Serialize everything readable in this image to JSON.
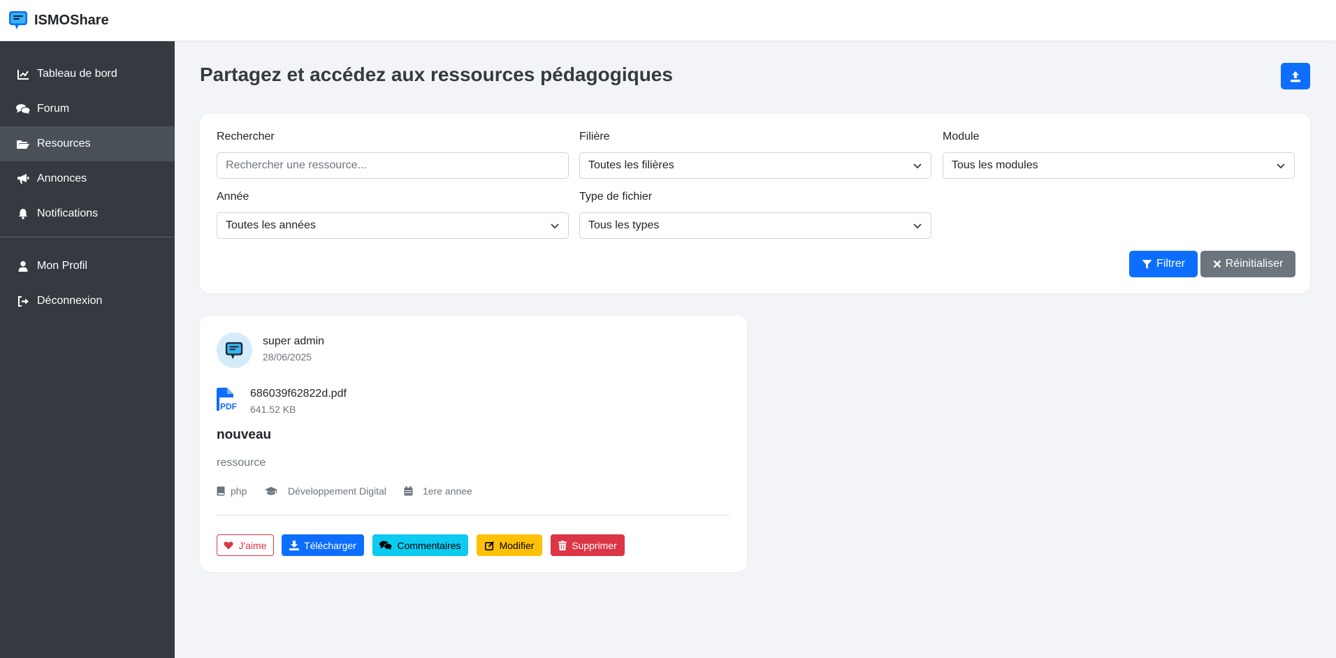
{
  "app": {
    "name": "ISMOShare"
  },
  "sidebar": {
    "items": [
      {
        "label": "Tableau de bord",
        "icon": "chart-line-icon"
      },
      {
        "label": "Forum",
        "icon": "comments-icon"
      },
      {
        "label": "Resources",
        "icon": "folder-open-icon",
        "active": true
      },
      {
        "label": "Annonces",
        "icon": "bullhorn-icon"
      },
      {
        "label": "Notifications",
        "icon": "bell-icon"
      }
    ],
    "bottom_items": [
      {
        "label": "Mon Profil",
        "icon": "user-icon"
      },
      {
        "label": "Déconnexion",
        "icon": "sign-out-icon"
      }
    ]
  },
  "page": {
    "title": "Partagez et accédez aux ressources pédagogiques"
  },
  "filters": {
    "search": {
      "label": "Rechercher",
      "placeholder": "Rechercher une ressource..."
    },
    "filiere": {
      "label": "Filière",
      "value": "Toutes les filières"
    },
    "module": {
      "label": "Module",
      "value": "Tous les modules"
    },
    "annee": {
      "label": "Année",
      "value": "Toutes les années"
    },
    "type": {
      "label": "Type de fichier",
      "value": "Tous les types"
    },
    "filter_button": "Filtrer",
    "reset_button": "Réinitialiser"
  },
  "resource": {
    "author": "super admin",
    "date": "28/06/2025",
    "file_name": "686039f62822d.pdf",
    "file_size": "641.52 KB",
    "file_type_badge": "PDF",
    "title": "nouveau",
    "description": "ressource",
    "module": "php",
    "filiere": "Développement Digital",
    "annee": "1ere annee",
    "actions": {
      "like": "J'aime",
      "download": "Télécharger",
      "comments": "Commentaires",
      "edit": "Modifier",
      "delete": "Supprimer"
    }
  },
  "colors": {
    "primary": "#0d6efd",
    "secondary": "#6c757d",
    "danger": "#dc3545",
    "info": "#0dcaf0",
    "warning": "#ffc107",
    "sidebar_bg": "#343a40",
    "sidebar_active": "#4a5057",
    "page_bg": "#f3f4f8"
  }
}
